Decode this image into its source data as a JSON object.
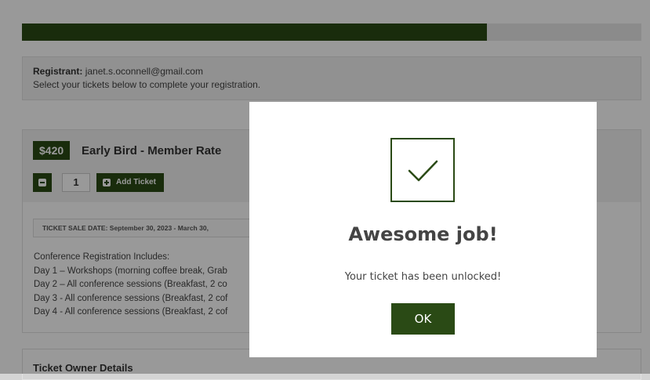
{
  "progress": {
    "fraction": 0.75
  },
  "registrant": {
    "label": "Registrant:",
    "email": "janet.s.oconnell@gmail.com",
    "instructions": "Select your tickets below to complete your registration."
  },
  "ticket": {
    "price": "$420",
    "name": "Early Bird - Member Rate",
    "quantity": "1",
    "add_label": "Add Ticket",
    "sale_date": "TICKET SALE DATE: September 30, 2023 - March 30,",
    "includes": [
      "Conference Registration Includes:",
      "Day 1 – Workshops (morning coffee break, Grab",
      "Day 2 – All conference sessions (Breakfast, 2 co",
      "Day 3 - All conference sessions (Breakfast, 2 cof",
      "Day 4 - All conference sessions (Breakfast, 2 cof"
    ]
  },
  "owner": {
    "title": "Ticket Owner Details"
  },
  "modal": {
    "icon": "checkmark-icon",
    "title": "Awesome job!",
    "message": "Your ticket has been unlocked!",
    "ok_label": "OK"
  },
  "colors": {
    "accent": "#2a4a15",
    "overlay": "rgba(0,0,0,0.4)"
  }
}
